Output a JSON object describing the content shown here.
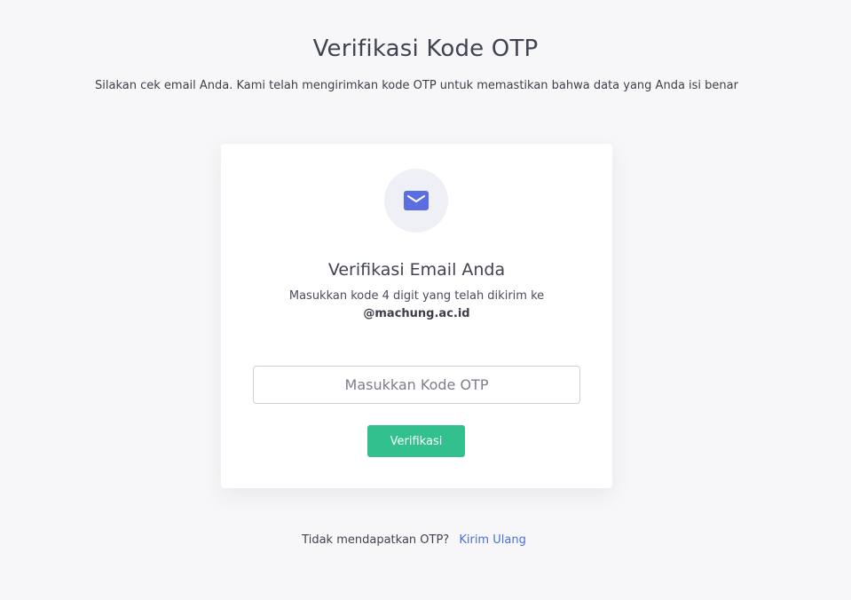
{
  "header": {
    "title": "Verifikasi Kode OTP",
    "subtitle": "Silakan cek email Anda. Kami telah mengirimkan kode OTP untuk memastikan bahwa data yang Anda isi benar"
  },
  "card": {
    "icon": "mail-icon",
    "title": "Verifikasi Email Anda",
    "description": "Masukkan kode 4 digit yang telah dikirim ke",
    "email": "@machung.ac.id",
    "otp_input": {
      "value": "",
      "placeholder": "Masukkan Kode OTP"
    },
    "verify_label": "Verifikasi"
  },
  "footer": {
    "question": "Tidak mendapatkan OTP?",
    "resend_label": "Kirim Ulang"
  },
  "colors": {
    "background": "#f7f7f9",
    "card": "#ffffff",
    "icon_accent": "#5b6ee1",
    "icon_circle": "#eef0f6",
    "primary_button": "#33c08f",
    "link": "#4a6fd9"
  }
}
